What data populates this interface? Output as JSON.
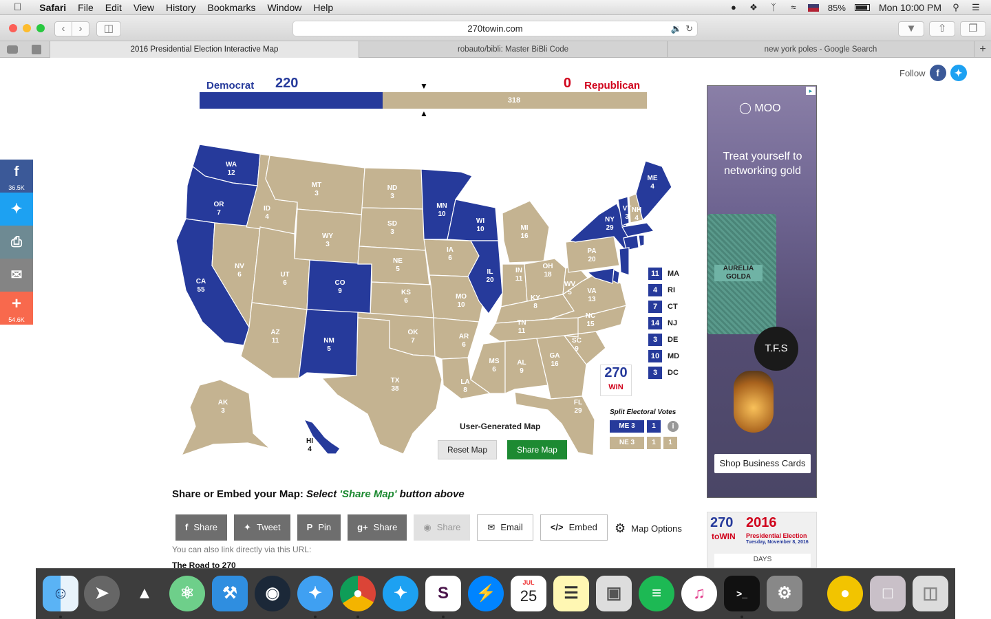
{
  "menubar": {
    "apple": "",
    "app_name": "Safari",
    "menus": [
      "File",
      "Edit",
      "View",
      "History",
      "Bookmarks",
      "Window",
      "Help"
    ],
    "battery": "85%",
    "clock": "Mon 10:00 PM"
  },
  "browser": {
    "url": "270towin.com",
    "tabs": [
      {
        "label": "2016 Presidential Election Interactive Map",
        "active": true
      },
      {
        "label": "robauto/bibli: Master BiBli Code",
        "active": false
      },
      {
        "label": "new york poles - Google Search",
        "active": false
      }
    ]
  },
  "side_social": {
    "facebook_count": "36.5K",
    "addthis_count": "54.6K"
  },
  "follow": {
    "label": "Follow"
  },
  "tally": {
    "dem_label": "Democrat",
    "dem_total": "220",
    "rep_total": "0",
    "rep_label": "Republican",
    "tossup_total": "318",
    "dem_fraction": 0.409,
    "colors": {
      "dem": "#263a9b",
      "rep": "#d0021b",
      "tossup": "#c4b391"
    }
  },
  "states": [
    {
      "id": "WA",
      "ev": "12",
      "party": "dem"
    },
    {
      "id": "OR",
      "ev": "7",
      "party": "dem"
    },
    {
      "id": "CA",
      "ev": "55",
      "party": "dem"
    },
    {
      "id": "NV",
      "ev": "6",
      "party": "tossup"
    },
    {
      "id": "ID",
      "ev": "4",
      "party": "tossup"
    },
    {
      "id": "MT",
      "ev": "3",
      "party": "tossup"
    },
    {
      "id": "WY",
      "ev": "3",
      "party": "tossup"
    },
    {
      "id": "UT",
      "ev": "6",
      "party": "tossup"
    },
    {
      "id": "AZ",
      "ev": "11",
      "party": "tossup"
    },
    {
      "id": "CO",
      "ev": "9",
      "party": "dem"
    },
    {
      "id": "NM",
      "ev": "5",
      "party": "dem"
    },
    {
      "id": "ND",
      "ev": "3",
      "party": "tossup"
    },
    {
      "id": "SD",
      "ev": "3",
      "party": "tossup"
    },
    {
      "id": "NE",
      "ev": "5",
      "party": "tossup"
    },
    {
      "id": "KS",
      "ev": "6",
      "party": "tossup"
    },
    {
      "id": "OK",
      "ev": "7",
      "party": "tossup"
    },
    {
      "id": "TX",
      "ev": "38",
      "party": "tossup"
    },
    {
      "id": "MN",
      "ev": "10",
      "party": "dem"
    },
    {
      "id": "IA",
      "ev": "6",
      "party": "tossup"
    },
    {
      "id": "MO",
      "ev": "10",
      "party": "tossup"
    },
    {
      "id": "AR",
      "ev": "6",
      "party": "tossup"
    },
    {
      "id": "LA",
      "ev": "8",
      "party": "tossup"
    },
    {
      "id": "WI",
      "ev": "10",
      "party": "dem"
    },
    {
      "id": "IL",
      "ev": "20",
      "party": "dem"
    },
    {
      "id": "MI",
      "ev": "16",
      "party": "tossup"
    },
    {
      "id": "IN",
      "ev": "11",
      "party": "tossup"
    },
    {
      "id": "OH",
      "ev": "18",
      "party": "tossup"
    },
    {
      "id": "KY",
      "ev": "8",
      "party": "tossup"
    },
    {
      "id": "TN",
      "ev": "11",
      "party": "tossup"
    },
    {
      "id": "MS",
      "ev": "6",
      "party": "tossup"
    },
    {
      "id": "AL",
      "ev": "9",
      "party": "tossup"
    },
    {
      "id": "GA",
      "ev": "16",
      "party": "tossup"
    },
    {
      "id": "FL",
      "ev": "29",
      "party": "tossup"
    },
    {
      "id": "SC",
      "ev": "9",
      "party": "tossup"
    },
    {
      "id": "NC",
      "ev": "15",
      "party": "tossup"
    },
    {
      "id": "VA",
      "ev": "13",
      "party": "tossup"
    },
    {
      "id": "WV",
      "ev": "5",
      "party": "tossup"
    },
    {
      "id": "PA",
      "ev": "20",
      "party": "tossup"
    },
    {
      "id": "NY",
      "ev": "29",
      "party": "dem"
    },
    {
      "id": "VT",
      "ev": "3",
      "party": "dem"
    },
    {
      "id": "NH",
      "ev": "4",
      "party": "tossup"
    },
    {
      "id": "ME",
      "ev": "4",
      "party": "dem"
    },
    {
      "id": "AK",
      "ev": "3",
      "party": "tossup"
    },
    {
      "id": "HI",
      "ev": "4",
      "party": "dem"
    }
  ],
  "small_states": [
    {
      "ev": "11",
      "abbr": "MA"
    },
    {
      "ev": "4",
      "abbr": "RI"
    },
    {
      "ev": "7",
      "abbr": "CT"
    },
    {
      "ev": "14",
      "abbr": "NJ"
    },
    {
      "ev": "3",
      "abbr": "DE"
    },
    {
      "ev": "10",
      "abbr": "MD"
    },
    {
      "ev": "3",
      "abbr": "DC"
    }
  ],
  "logo": {
    "num": "270",
    "to": "to",
    "win": "WIN"
  },
  "split": {
    "title": "Split Electoral Votes",
    "me_label": "ME 3",
    "me_d1": "1",
    "ne_label": "NE 3",
    "ne_d1": "1",
    "ne_d2": "1"
  },
  "map_controls": {
    "title": "User-Generated Map",
    "reset": "Reset Map",
    "share": "Share Map"
  },
  "embed": {
    "prefix": "Share or Embed your Map:",
    "select": "Select",
    "quote": "'Share Map'",
    "suffix": "button above",
    "buttons": {
      "facebook": "Share",
      "twitter": "Tweet",
      "pinterest": "Pin",
      "gplus": "Share",
      "reddit": "Share",
      "email": "Email",
      "embed": "Embed"
    },
    "map_options": "Map Options",
    "link_note": "You can also link directly via this URL:",
    "road": "The Road to 270"
  },
  "ad": {
    "brand": "MOO",
    "headline": "Treat yourself to networking gold",
    "card_name": "AURELIA GOLDA",
    "tfs": "T.F.S",
    "cta": "Shop Business Cards"
  },
  "promo": {
    "num": "270",
    "win": "toWIN",
    "year": "2016",
    "sub": "Presidential Election",
    "date": "Tuesday, November 8, 2016",
    "days": "DAYS"
  },
  "dock": {
    "calendar_month": "JUL",
    "calendar_day": "25"
  }
}
